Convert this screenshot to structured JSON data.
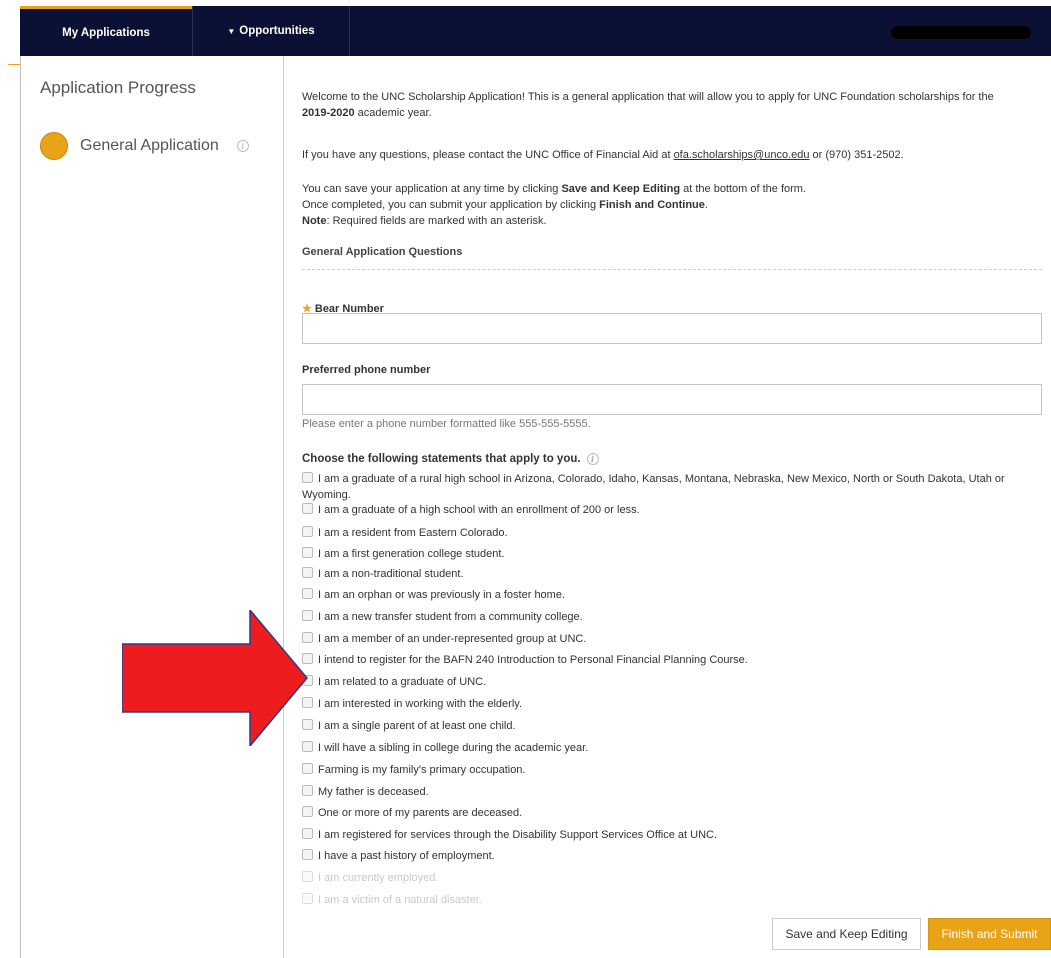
{
  "nav": {
    "tab_my_applications": "My Applications",
    "tab_opportunities": "Opportunities"
  },
  "sidebar": {
    "heading": "Application Progress",
    "step_label": "General Application"
  },
  "intro": {
    "line1_a": "Welcome to the UNC Scholarship Application! This is a general application that will allow you to apply for UNC Foundation scholarships for the ",
    "line1_year": "2019-2020",
    "line1_b": " academic year.",
    "contact_a": "If you have any questions, please contact the UNC Office of Financial Aid at ",
    "contact_email": "ofa.scholarships@unco.edu",
    "contact_b": " or (970) 351-2502.",
    "save_a": "You can save your application at any time by clicking ",
    "save_bold": "Save and Keep Editing",
    "save_b": " at the bottom of the form.",
    "submit_a": "Once completed, you can submit your application by clicking ",
    "submit_bold": "Finish and Continue",
    "submit_b": ".",
    "note_bold": "Note",
    "note_text": ": Required fields are marked with an asterisk."
  },
  "section_title": "General Application Questions",
  "fields": {
    "bear_label": "Bear Number",
    "phone_label": "Preferred phone number",
    "phone_hint": "Please enter a phone number formatted like 555-555-5555."
  },
  "choose_label": "Choose the following statements that apply to you.",
  "options": [
    "I am a graduate of a rural high school in Arizona, Colorado, Idaho, Kansas, Montana, Nebraska, New Mexico, North or South Dakota, Utah or Wyoming.",
    "I am a graduate of a high school with an enrollment of 200 or less.",
    "I am a resident from Eastern Colorado.",
    "I am a first generation college student.",
    "I am a non-traditional student.",
    "I am an orphan or was previously in a foster home.",
    "I am a new transfer student from a community college.",
    "I am a member of an under-represented group at UNC.",
    "I intend to register for the BAFN 240 Introduction to Personal Financial Planning Course.",
    "I am related to a graduate of UNC.",
    "I am interested in working with the elderly.",
    "I am a single parent of at least one child.",
    "I will have a sibling in college during the academic year.",
    "Farming is my family's primary occupation.",
    "My father is deceased.",
    "One or more of my parents are deceased.",
    "I am registered for services through the Disability Support Services Office at UNC.",
    "I have a past history of employment.",
    "I am currently employed.",
    "I am a victim of a natural disaster."
  ],
  "buttons": {
    "save": "Save and Keep Editing",
    "finish": "Finish and Submit"
  },
  "colors": {
    "nav_bg": "#0b1134",
    "accent": "#e8a317",
    "arrow": "#ee1c1c"
  }
}
